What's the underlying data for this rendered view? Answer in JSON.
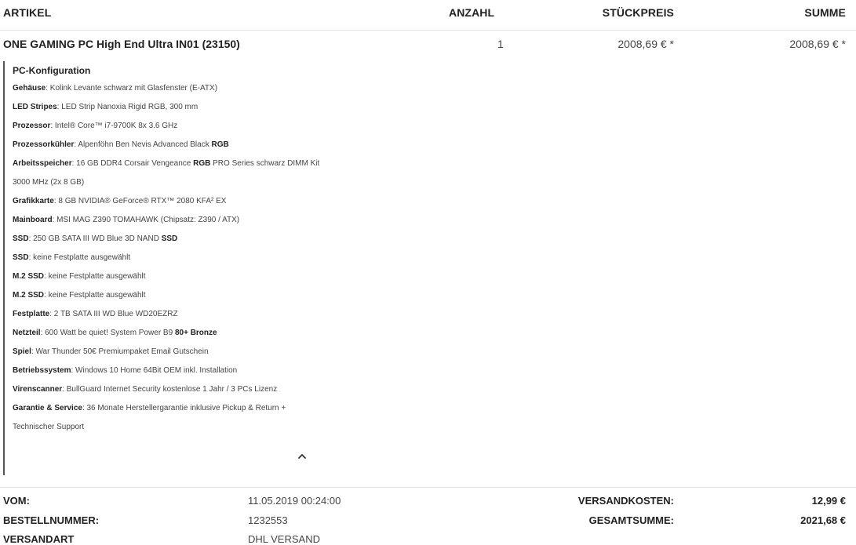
{
  "table": {
    "headers": {
      "artikel": "ARTIKEL",
      "anzahl": "ANZAHL",
      "stueckpreis": "STÜCKPREIS",
      "summe": "SUMME"
    },
    "item": {
      "name": "ONE GAMING PC High End Ultra IN01 (23150)",
      "quantity": "1",
      "unit_price": "2008,69 € *",
      "total": "2008,69 € *"
    }
  },
  "config": {
    "title": "PC-Konfiguration",
    "lines": [
      [
        {
          "t": "Gehäuse",
          "b": true
        },
        {
          "t": ": Kolink Levante schwarz mit Glasfenster (E-ATX)",
          "b": false
        }
      ],
      [
        {
          "t": "LED Stripes",
          "b": true
        },
        {
          "t": ": LED Strip Nanoxia Rigid RGB, 300 mm",
          "b": false
        }
      ],
      [
        {
          "t": "Prozessor",
          "b": true
        },
        {
          "t": ": Intel® Core™ i7-9700K 8x 3.6 GHz",
          "b": false
        }
      ],
      [
        {
          "t": "Prozessorkühler",
          "b": true
        },
        {
          "t": ": Alpenföhn Ben Nevis Advanced Black ",
          "b": false
        },
        {
          "t": "RGB",
          "b": true
        }
      ],
      [
        {
          "t": "Arbeitsspeicher",
          "b": true
        },
        {
          "t": ": 16 GB DDR4 Corsair Vengeance ",
          "b": false
        },
        {
          "t": "RGB",
          "b": true
        },
        {
          "t": " PRO Series schwarz DIMM Kit",
          "b": false
        }
      ],
      [
        {
          "t": "3000 MHz (2x 8 GB)",
          "b": false
        }
      ],
      [
        {
          "t": "Grafikkarte",
          "b": true
        },
        {
          "t": ": 8 GB NVIDIA® GeForce® RTX™ 2080 KFA² EX",
          "b": false
        }
      ],
      [
        {
          "t": "Mainboard",
          "b": true
        },
        {
          "t": ": MSI MAG Z390 TOMAHAWK (Chipsatz: Z390 / ATX)",
          "b": false
        }
      ],
      [
        {
          "t": "SSD",
          "b": true
        },
        {
          "t": ": 250 GB SATA III WD Blue 3D NAND ",
          "b": false
        },
        {
          "t": "SSD",
          "b": true
        }
      ],
      [
        {
          "t": "SSD",
          "b": true
        },
        {
          "t": ": keine Festplatte ausgewählt",
          "b": false
        }
      ],
      [
        {
          "t": "M.2 SSD",
          "b": true
        },
        {
          "t": ": keine Festplatte ausgewählt",
          "b": false
        }
      ],
      [
        {
          "t": "M.2 SSD",
          "b": true
        },
        {
          "t": ": keine Festplatte ausgewählt",
          "b": false
        }
      ],
      [
        {
          "t": "Festplatte",
          "b": true
        },
        {
          "t": ": 2 TB SATA III WD Blue WD20EZRZ",
          "b": false
        }
      ],
      [
        {
          "t": "Netzteil",
          "b": true
        },
        {
          "t": ": 600 Watt be quiet! System Power B9 ",
          "b": false
        },
        {
          "t": "80+ Bronze",
          "b": true
        }
      ],
      [
        {
          "t": "Spiel",
          "b": true
        },
        {
          "t": ": War Thunder 50€ Premiumpaket Email Gutschein",
          "b": false
        }
      ],
      [
        {
          "t": "Betriebssystem",
          "b": true
        },
        {
          "t": ": Windows 10 Home 64Bit OEM inkl. Installation",
          "b": false
        }
      ],
      [
        {
          "t": "Virenscanner",
          "b": true
        },
        {
          "t": ": BullGuard Internet Security kostenlose 1 Jahr / 3 PCs Lizenz",
          "b": false
        }
      ],
      [
        {
          "t": "Garantie & Service",
          "b": true
        },
        {
          "t": ": 36 Monate Herstellergarantie inklusive Pickup & Return +",
          "b": false
        }
      ],
      [
        {
          "t": "Technischer Support",
          "b": false
        }
      ]
    ],
    "collapse_icon": "chevron-up-icon"
  },
  "order": {
    "vom_label": "VOM:",
    "vom_value": "11.05.2019 00:24:00",
    "bestellnummer_label": "BESTELLNUMMER:",
    "bestellnummer_value": "1232553",
    "versandart_label": "VERSANDART",
    "versandart_value": "DHL VERSAND",
    "versandkosten_label": "VERSANDKOSTEN:",
    "versandkosten_value": "12,99 €",
    "gesamtsumme_label": "GESAMTSUMME:",
    "gesamtsumme_value": "2021,68 €"
  }
}
